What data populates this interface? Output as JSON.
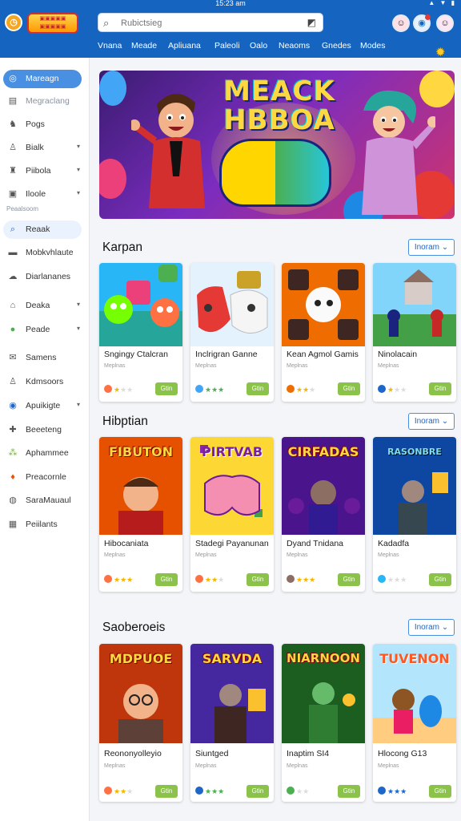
{
  "status_bar": {
    "time": "15:23 am",
    "icons": "▲ ▼ ▮"
  },
  "header": {
    "app_icon": "clock-icon",
    "brand": "game-store-logo",
    "search": {
      "value": "",
      "placeholder": "Rubictsieg"
    },
    "nav": [
      "Vnana",
      "Meade",
      "Apliuana",
      "Paleoli",
      "Oalo",
      "Neaoms",
      "Gnedes",
      "Modes"
    ],
    "accent": "#1565c0"
  },
  "sidebar": {
    "items": [
      {
        "label": "Mareagn",
        "icon": "target-icon",
        "active": true
      },
      {
        "label": "Megraclang",
        "icon": "store-icon",
        "faded": true
      },
      {
        "label": "Pogs",
        "icon": "joystick-icon"
      },
      {
        "label": "Bialk",
        "icon": "user-icon",
        "chevron": true
      },
      {
        "label": "Piibola",
        "icon": "bag-icon",
        "chevron": true
      },
      {
        "label": "Iloole",
        "icon": "play-box-icon",
        "chevron": true
      },
      {
        "label": "Reaak",
        "icon": "search-icon",
        "light": true
      },
      {
        "label": "Mobkvhlaute",
        "icon": "car-icon"
      },
      {
        "label": "Diarlananes",
        "icon": "cloud-icon"
      },
      {
        "label": "Deaka",
        "icon": "house-icon",
        "chevron": true
      },
      {
        "label": "Peade",
        "icon": "coin-icon",
        "chevron": true
      },
      {
        "label": "Samens",
        "icon": "mail-icon"
      },
      {
        "label": "Kdmsoors",
        "icon": "user-icon"
      },
      {
        "label": "Apuikigte",
        "icon": "circle-icon",
        "chevron": true
      },
      {
        "label": "Beeeteng",
        "icon": "puzzle-icon"
      },
      {
        "label": "Aphammee",
        "icon": "molecule-icon"
      },
      {
        "label": "Preacornle",
        "icon": "gift-icon"
      },
      {
        "label": "SaraMauaul",
        "icon": "gamepad-icon"
      },
      {
        "label": "Peiilants",
        "icon": "calendar-icon"
      }
    ],
    "section_label": "Peaalsoom"
  },
  "banner": {
    "title_line1": "MEACK",
    "title_line2": "HBBOA"
  },
  "sections": [
    {
      "title": "Karpan",
      "more": "Inoram",
      "cards": [
        {
          "name": "Sngingy Ctalcran",
          "sub": "Meplnas",
          "stars": 1,
          "color": "#ff7043",
          "get": "Gtin"
        },
        {
          "name": "Inclrigran Ganne",
          "sub": "Meplnas",
          "stars": 3,
          "color": "#42a5f5",
          "get": "Gtin"
        },
        {
          "name": "Kean Agmol Gamis",
          "sub": "Meplnas",
          "stars": 2,
          "color": "#ef6c00",
          "get": "Gtin"
        },
        {
          "name": "Ninolacain",
          "sub": "Meplnas",
          "stars": 1,
          "color": "#1e66c7",
          "get": "Gtin"
        }
      ]
    },
    {
      "title": "Hibptian",
      "more": "Inoram",
      "cards": [
        {
          "name": "Hibocaniata",
          "sub": "Meplnas",
          "stars": 3,
          "color": "#ff7043",
          "get": "Gtin",
          "overtext": "FIBUTON"
        },
        {
          "name": "Stadegi Payanunan",
          "sub": "Meplnas",
          "stars": 2,
          "color": "#ff7043",
          "get": "Gtin",
          "overtext": "PIRTVAB"
        },
        {
          "name": "Dyand Tnidana",
          "sub": "Meplnas",
          "stars": 3,
          "color": "#8d6e63",
          "get": "Gtin",
          "overtext": "CIRFADAS"
        },
        {
          "name": "Kadadfa",
          "sub": "Meplnas",
          "stars": 0,
          "color": "#29b6f6",
          "get": "Gtin",
          "overtext": "RASONBRE"
        }
      ]
    },
    {
      "title": "Saoberoeis",
      "more": "Inoram",
      "cards": [
        {
          "name": "Reononyolleyio",
          "sub": "Meplnas",
          "stars": 2,
          "color": "#ff7043",
          "get": "Gtin",
          "overtext": "MDPUOE"
        },
        {
          "name": "Siuntged",
          "sub": "Meplnas",
          "stars": 3,
          "color": "#1e66c7",
          "get": "Gtin",
          "overtext": "SARVDA"
        },
        {
          "name": "Inaptim SI4",
          "sub": "Meplnas",
          "stars": 0,
          "color": "#4caf50",
          "get": "Gtin",
          "overtext": "NIARNOON"
        },
        {
          "name": "Hlocong G13",
          "sub": "Meplnas",
          "stars": 3,
          "color": "#1e66c7",
          "get": "Gtin",
          "overtext": "TUVENON"
        }
      ]
    }
  ]
}
